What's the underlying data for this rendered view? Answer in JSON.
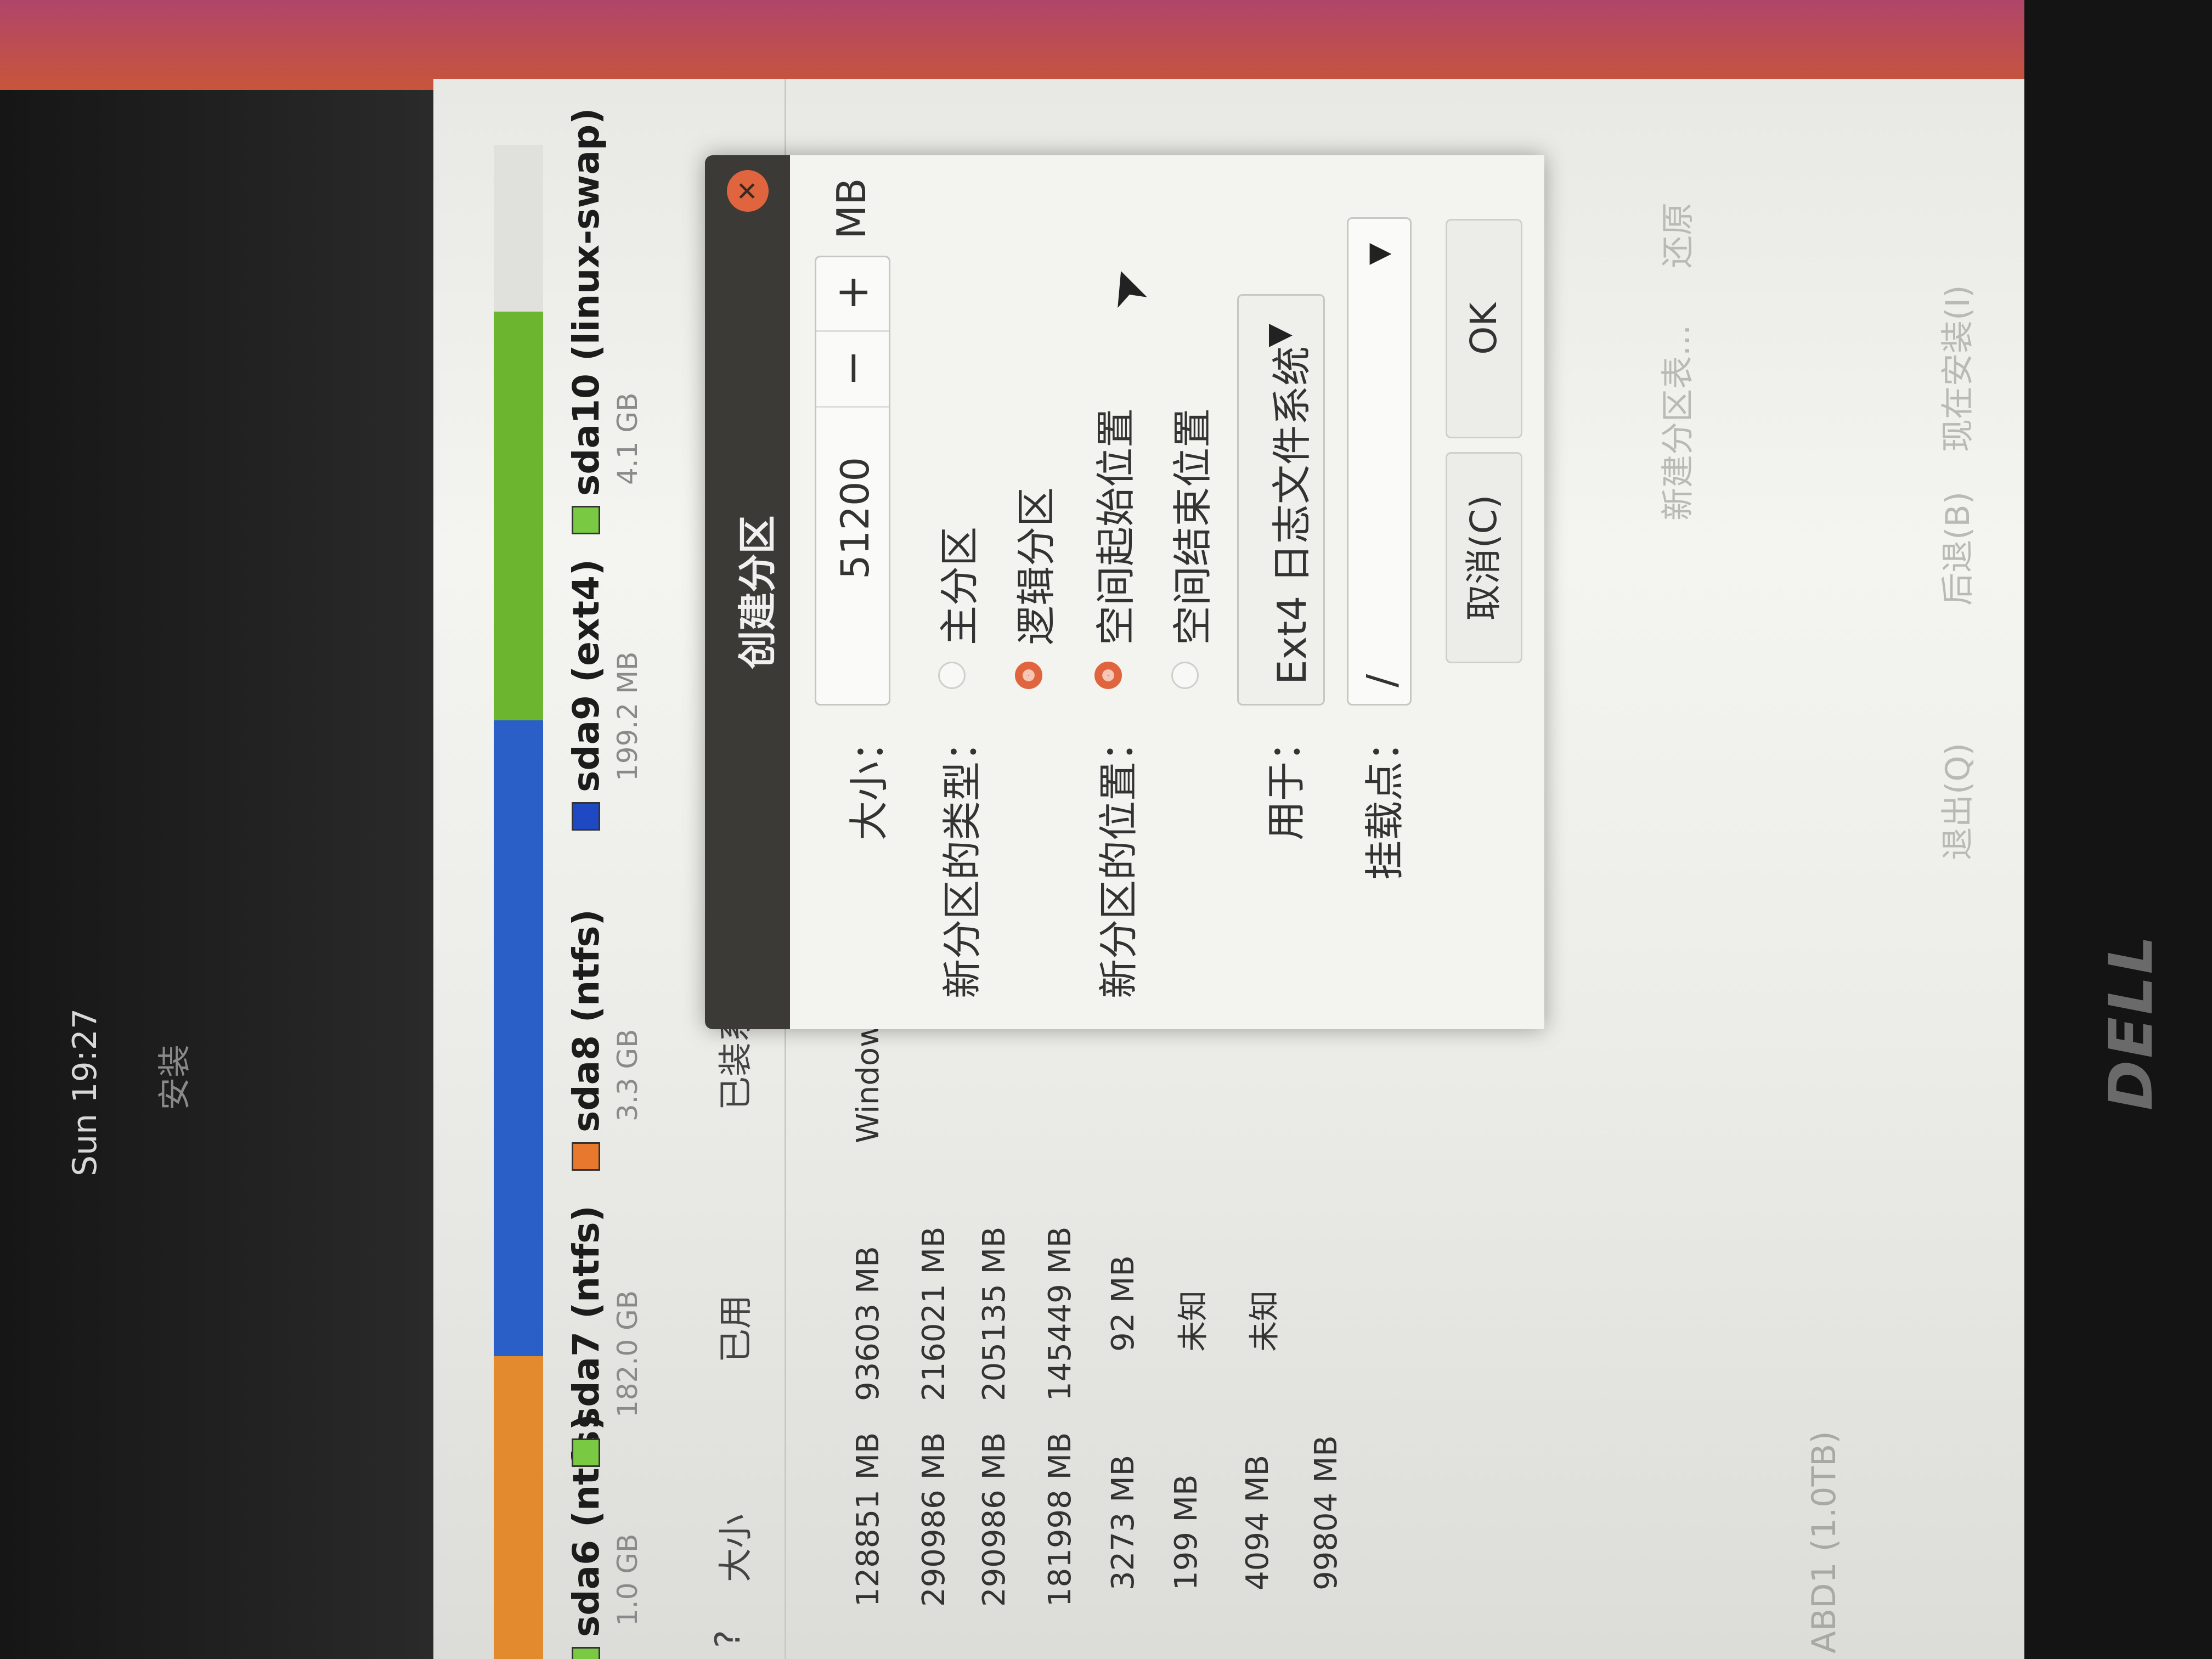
{
  "topbar": {
    "clock": "Sun 19:27",
    "window_title": "安装"
  },
  "partition_bar": {
    "segments": [
      {
        "name": "sda7",
        "color": "#e38a2e",
        "fraction": 0.19
      },
      {
        "name": "sda8",
        "color": "#e38a2e",
        "fraction": 0.01
      },
      {
        "name": "sda9",
        "color": "#2a5fc7",
        "fraction": 0.42
      },
      {
        "name": "sda10",
        "color": "#6bb52f",
        "fraction": 0.27
      },
      {
        "name": "free",
        "color": "#e0e0dc",
        "fraction": 0.05
      }
    ]
  },
  "legend": [
    {
      "name": "sda6 (ntfs)",
      "size": "1.0 GB",
      "color": "#7ac943"
    },
    {
      "name": "sda7 (ntfs)",
      "size": "182.0 GB",
      "color": "#7ac943"
    },
    {
      "name": "sda8 (ntfs)",
      "size": "3.3 GB",
      "color": "#e8782e"
    },
    {
      "name": "sda9 (ext4)",
      "size": "199.2 MB",
      "color": "#1f49c2"
    },
    {
      "name": "sda10 (linux-swap)",
      "size": "4.1 GB",
      "color": "#7ac943"
    }
  ],
  "table": {
    "headers": [
      "?",
      "大小",
      "已用",
      "已装系统"
    ],
    "rows": [
      {
        "size": "128851 MB",
        "used": "93603 MB",
        "system": "Windows"
      },
      {
        "size": "290986 MB",
        "used": "216021 MB",
        "system": ""
      },
      {
        "size": "290986 MB",
        "used": "205135 MB",
        "system": ""
      },
      {
        "size": "181998 MB",
        "used": "145449 MB",
        "system": ""
      },
      {
        "size": "3273 MB",
        "used": "92 MB",
        "system": ""
      },
      {
        "size": "199 MB",
        "used": "未知",
        "system": ""
      },
      {
        "size": "4094 MB",
        "used": "未知",
        "system": ""
      },
      {
        "size": "99804 MB",
        "used": "",
        "system": ""
      }
    ]
  },
  "dialog": {
    "title": "创建分区",
    "size_label": "大小：",
    "size_value": "51200",
    "size_unit": "MB",
    "minus": "−",
    "plus": "+",
    "type_label": "新分区的类型：",
    "type_primary": "主分区",
    "type_logical": "逻辑分区",
    "type_selected": "logical",
    "location_label": "新分区的位置：",
    "location_start": "空间起始位置",
    "location_end": "空间结束位置",
    "location_selected": "start",
    "use_label": "用于：",
    "use_value": "Ext4 日志文件系统",
    "mount_label": "挂载点：",
    "mount_value": "/",
    "cancel": "取消(C)",
    "ok": "OK",
    "accent": "#e0653f"
  },
  "background_actions": {
    "new_table": "新建分区表...",
    "revert": "还原",
    "quit": "退出(Q)",
    "back": "后退(B)",
    "install_now": "现在安装(I)"
  },
  "device_label": "ABD1 (1.0TB)",
  "bezel_logo": "DELL"
}
